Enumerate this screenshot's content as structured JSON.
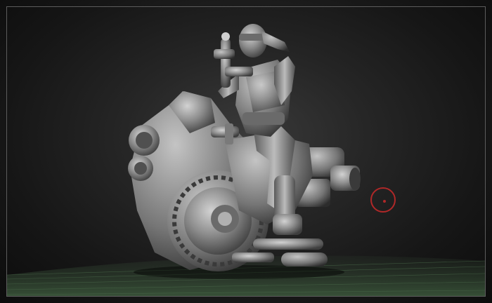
{
  "app": {
    "view": "3d-viewport"
  },
  "model": {
    "subject": ""
  },
  "colors": {
    "background_center": "#3a3a3a",
    "background_edge": "#0c0c0c",
    "floor_grid": "#3d5a3d",
    "frame_border": "#5c5c5c",
    "brush_cursor": "#b02828",
    "model_shading": "#9a9a9a"
  },
  "tools": {
    "brush_cursor_icon": "brush-circle-icon"
  }
}
